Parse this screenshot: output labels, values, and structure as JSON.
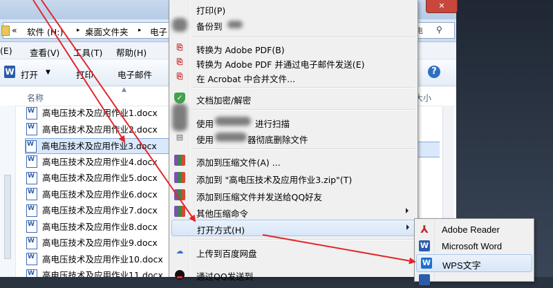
{
  "explorer": {
    "address_segments": [
      "«",
      "软件 (H:)",
      "▸",
      "桌面文件夹",
      "▸",
      "电子"
    ],
    "search_hint": "电",
    "menubar": [
      "(E)",
      "查看(V)",
      "工具(T)",
      "帮助(H)"
    ],
    "toolbar": {
      "open": "打开",
      "print": "打印",
      "email": "电子邮件",
      "help": "?"
    },
    "col_name": "名称",
    "col_size": "大小",
    "files": [
      "高电压技术及应用作业1.docx",
      "高电压技术及应用作业2.docx",
      "高电压技术及应用作业3.docx",
      "高电压技术及应用作业4.docx",
      "高电压技术及应用作业5.docx",
      "高电压技术及应用作业6.docx",
      "高电压技术及应用作业7.docx",
      "高电压技术及应用作业8.docx",
      "高电压技术及应用作业9.docx",
      "高电压技术及应用作业10.docx",
      "高电压技术及应用作业11.docx"
    ],
    "selected_index": 2
  },
  "context_menu": {
    "print": "打印(P)",
    "backup": "备份到",
    "to_pdf": "转换为 Adobe PDF(B)",
    "to_pdf_email": "转换为 Adobe PDF 并通过电子邮件发送(E)",
    "acrobat_merge": "在 Acrobat 中合并文件...",
    "encrypt": "文档加密/解密",
    "scan_a": "使用",
    "scan_b": "进行扫描",
    "shred_a": "使用",
    "shred_b": "器彻底删除文件",
    "add_archive": "添加到压缩文件(A) ...",
    "add_zip": "添加到 \"高电压技术及应用作业3.zip\"(T)",
    "add_zip_qq": "添加到压缩文件并发送给QQ好友",
    "other_zip": "其他压缩命令",
    "open_with": "打开方式(H)",
    "baidu": "上传到百度网盘",
    "qq_send": "通过QQ发送到"
  },
  "submenu": {
    "adobe_reader": "Adobe Reader",
    "ms_word": "Microsoft Word",
    "wps": "WPS文字"
  },
  "colors": {
    "arrow": "#e3262b",
    "selection": "#d9e8fb",
    "menu_bg": "#f0f0f0"
  }
}
